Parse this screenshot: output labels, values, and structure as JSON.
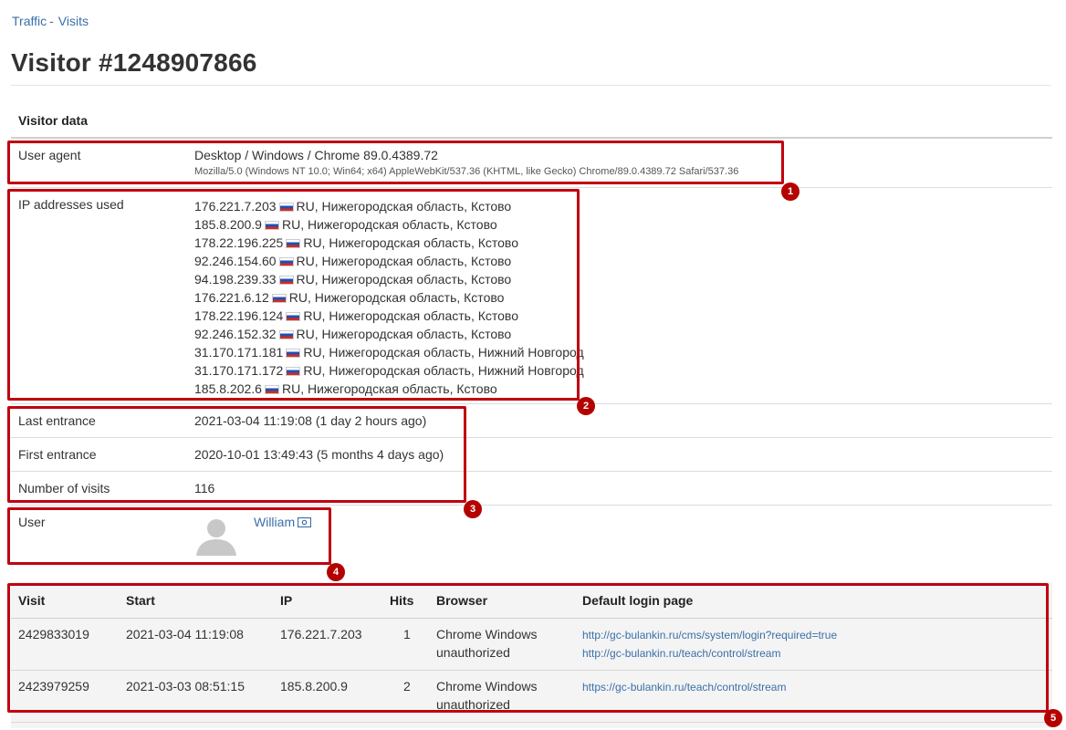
{
  "breadcrumb": {
    "items": [
      "Traffic",
      "Visits"
    ],
    "separator": "-"
  },
  "page_title": "Visitor #1248907866",
  "section_title": "Visitor data",
  "user_agent": {
    "label": "User agent",
    "summary": "Desktop / Windows / Chrome 89.0.4389.72",
    "full": "Mozilla/5.0 (Windows NT 10.0; Win64; x64) AppleWebKit/537.36 (KHTML, like Gecko) Chrome/89.0.4389.72 Safari/537.36"
  },
  "ips": {
    "label": "IP addresses used",
    "items": [
      {
        "ip": "176.221.7.203",
        "location": "RU, Нижегородская область, Кстово"
      },
      {
        "ip": "185.8.200.9",
        "location": "RU, Нижегородская область, Кстово"
      },
      {
        "ip": "178.22.196.225",
        "location": "RU, Нижегородская область, Кстово"
      },
      {
        "ip": "92.246.154.60",
        "location": "RU, Нижегородская область, Кстово"
      },
      {
        "ip": "94.198.239.33",
        "location": "RU, Нижегородская область, Кстово"
      },
      {
        "ip": "176.221.6.12",
        "location": "RU, Нижегородская область, Кстово"
      },
      {
        "ip": "178.22.196.124",
        "location": "RU, Нижегородская область, Кстово"
      },
      {
        "ip": "92.246.152.32",
        "location": "RU, Нижегородская область, Кстово"
      },
      {
        "ip": "31.170.171.181",
        "location": "RU, Нижегородская область, Нижний Новгород"
      },
      {
        "ip": "31.170.171.172",
        "location": "RU, Нижегородская область, Нижний Новгород"
      },
      {
        "ip": "185.8.202.6",
        "location": "RU, Нижегородская область, Кстово"
      }
    ],
    "flag_icon": "russia-flag-icon"
  },
  "stats": {
    "last_entrance_label": "Last entrance",
    "last_entrance_value": "2021-03-04 11:19:08 (1 day 2 hours ago)",
    "first_entrance_label": "First entrance",
    "first_entrance_value": "2020-10-01 13:49:43 (5 months 4 days ago)",
    "visits_label": "Number of visits",
    "visits_value": "116"
  },
  "user": {
    "label": "User",
    "name": "William",
    "avatar_icon": "user-avatar-icon",
    "card_icon": "id-card-icon"
  },
  "visits_table": {
    "headers": [
      "Visit",
      "Start",
      "IP",
      "Hits",
      "Browser",
      "Default login page"
    ],
    "rows": [
      {
        "visit": "2429833019",
        "start": "2021-03-04 11:19:08",
        "ip": "176.221.7.203",
        "hits": "1",
        "browser_line1": "Chrome Windows",
        "browser_line2": "unauthorized",
        "pages": [
          "http://gc-bulankin.ru/cms/system/login?required=true",
          "http://gc-bulankin.ru/teach/control/stream"
        ]
      },
      {
        "visit": "2423979259",
        "start": "2021-03-03 08:51:15",
        "ip": "185.8.200.9",
        "hits": "2",
        "browser_line1": "Chrome Windows",
        "browser_line2": "unauthorized",
        "pages": [
          "https://gc-bulankin.ru/teach/control/stream"
        ]
      }
    ]
  },
  "annotations": {
    "labels": [
      "1",
      "2",
      "3",
      "4",
      "5"
    ],
    "color": "#c00010"
  }
}
